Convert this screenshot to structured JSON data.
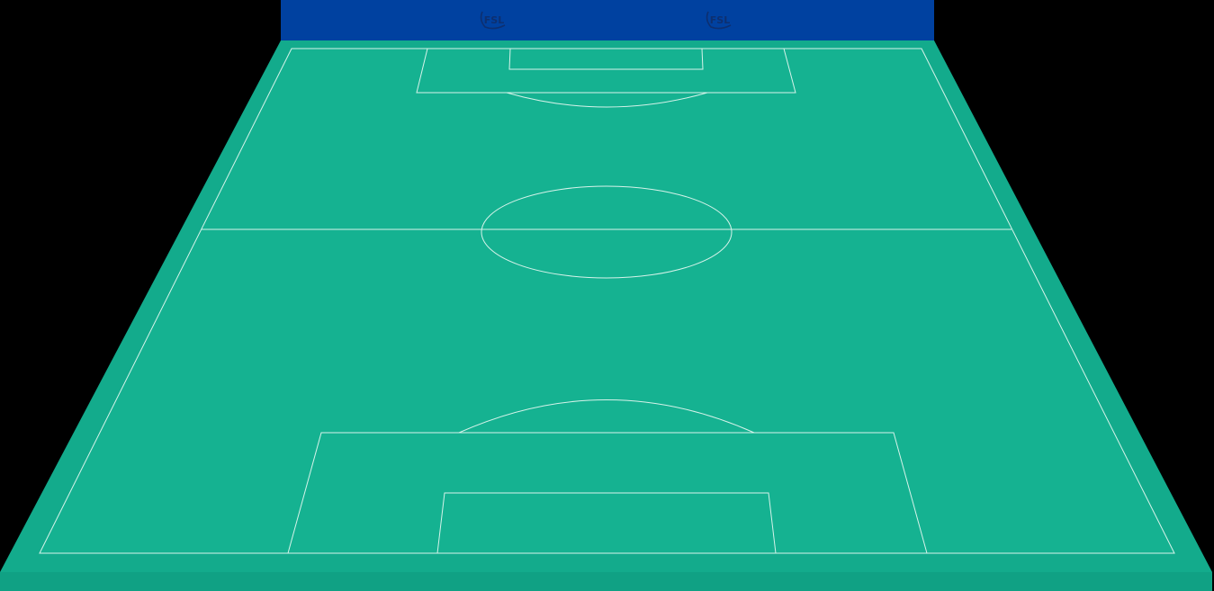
{
  "board": {
    "sponsor_logos": [
      {
        "text": "FSL"
      },
      {
        "text": "FSL"
      }
    ]
  },
  "colors": {
    "background": "#000000",
    "ad_board": "#0041a0",
    "pitch_surface": "#15b291",
    "pitch_surround": "#13ab8c",
    "pitch_front_edge": "#10a184",
    "line": "#d6f3ea",
    "logo": "#0d2f70"
  }
}
